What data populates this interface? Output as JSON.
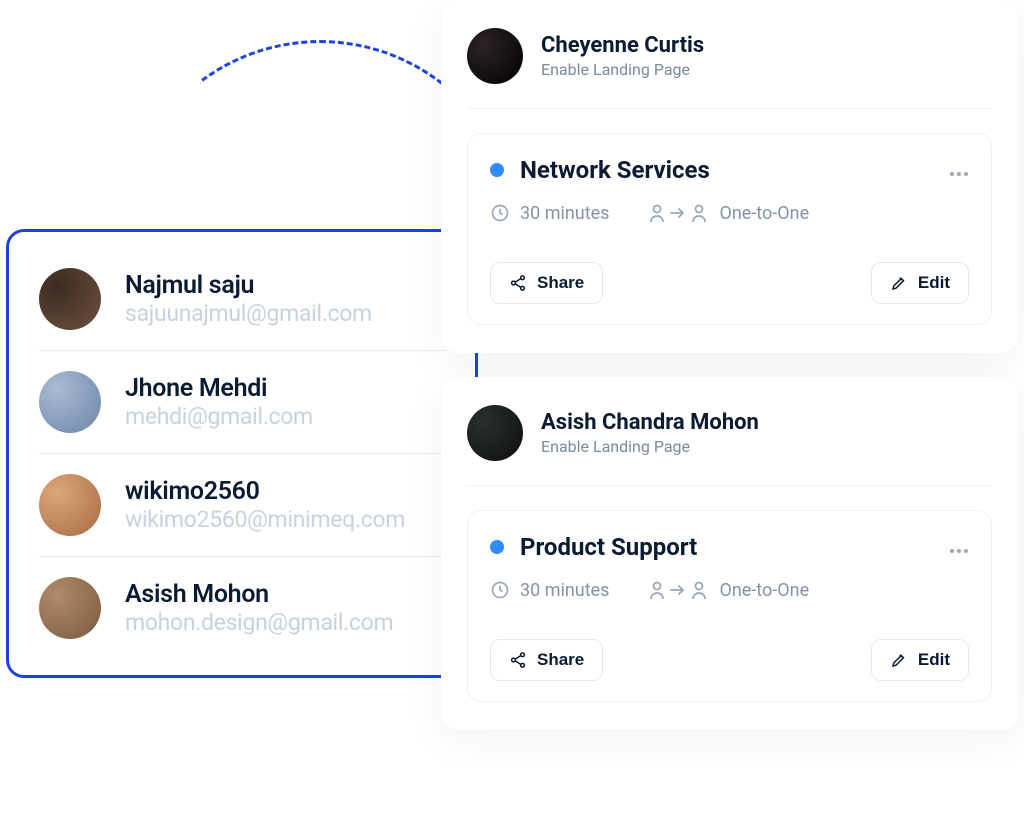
{
  "contacts": {
    "items": [
      {
        "name": "Najmul saju",
        "email": "sajuunajmul@gmail.com"
      },
      {
        "name": "Jhone Mehdi",
        "email": "mehdi@gmail.com"
      },
      {
        "name": "wikimo2560",
        "email": "wikimo2560@minimeq.com"
      },
      {
        "name": "Asish Mohon",
        "email": "mohon.design@gmail.com"
      }
    ]
  },
  "events": {
    "cards": [
      {
        "owner_name": "Cheyenne Curtis",
        "owner_sub": "Enable Landing Page",
        "title": "Network Services",
        "duration": "30 minutes",
        "mode": "One-to-One",
        "share_label": "Share",
        "edit_label": "Edit"
      },
      {
        "owner_name": "Asish Chandra Mohon",
        "owner_sub": "Enable Landing Page",
        "title": "Product Support",
        "duration": "30 minutes",
        "mode": "One-to-One",
        "share_label": "Share",
        "edit_label": "Edit"
      }
    ]
  }
}
